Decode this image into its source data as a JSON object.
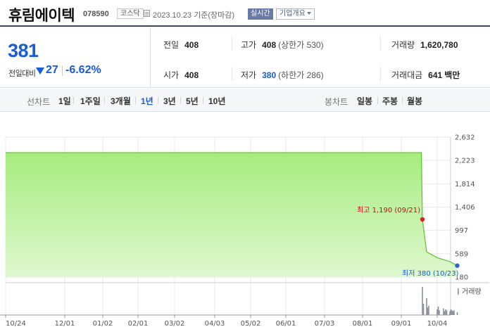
{
  "header": {
    "stock_name": "휴림에이텍",
    "stock_code": "078590",
    "market": "코스닥",
    "date_text": "2023.10.23 기준(장마감)",
    "realtime_label": "실시간",
    "company_info_label": "기업개요"
  },
  "price": {
    "current": "381",
    "change_label": "전일대비",
    "change_value": "27",
    "change_pct": "-6.62%",
    "direction": "down"
  },
  "metrics": {
    "prev_close_label": "전일",
    "prev_close": "408",
    "high_label": "고가",
    "high": "408",
    "upper_limit": "(상한가 530)",
    "volume_label": "거래량",
    "volume": "1,620,780",
    "open_label": "시가",
    "open": "408",
    "low_label": "저가",
    "low": "380",
    "lower_limit": "(하한가 286)",
    "amount_label": "거래대금",
    "amount": "641",
    "amount_unit": "백만"
  },
  "periods": {
    "line_label": "선차트",
    "line_items": [
      "1일",
      "1주일",
      "3개월",
      "1년",
      "3년",
      "5년",
      "10년"
    ],
    "active": "1년",
    "candle_label": "봉차트",
    "candle_items": [
      "일봉",
      "주봉",
      "월봉"
    ]
  },
  "colors": {
    "accent_blue": "#1a5bd6",
    "up_red": "#d0021b",
    "chart_fill": "#a6ec7f",
    "chart_line": "#5cc02e"
  },
  "chart_data": {
    "type": "area",
    "y_ticks": [
      "2,632",
      "2,223",
      "1,814",
      "1,406",
      "997",
      "589",
      "180"
    ],
    "ylim": [
      180,
      2632
    ],
    "x_ticks": [
      "10/24",
      "12/01",
      "01/02",
      "02/01",
      "03/02",
      "04/03",
      "05/02",
      "06/01",
      "07/03",
      "08/01",
      "09/01",
      "10/04"
    ],
    "series": [
      {
        "values": [
          [
            "10/24",
            2360
          ],
          [
            "12/01",
            2360
          ],
          [
            "01/02",
            2360
          ],
          [
            "02/01",
            2360
          ],
          [
            "03/02",
            2360
          ],
          [
            "04/03",
            2360
          ],
          [
            "05/02",
            2360
          ],
          [
            "06/01",
            2360
          ],
          [
            "07/03",
            2360
          ],
          [
            "08/01",
            2360
          ],
          [
            "09/01",
            2360
          ],
          [
            "09/20",
            2360
          ],
          [
            "09/21",
            1190
          ],
          [
            "09/25",
            620
          ],
          [
            "10/04",
            520
          ],
          [
            "10/16",
            450
          ],
          [
            "10/23",
            380
          ]
        ]
      }
    ],
    "annotations": {
      "high_label": "최고 1,190 (09/21)",
      "low_label": "최저 380 (10/23)"
    },
    "volume_label": "거래량",
    "volume_bars": [
      [
        "09/21",
        30
      ],
      [
        "09/22",
        12
      ],
      [
        "09/25",
        18
      ],
      [
        "09/26",
        8
      ],
      [
        "09/27",
        10
      ],
      [
        "10/04",
        6
      ],
      [
        "10/05",
        9
      ],
      [
        "10/06",
        5
      ],
      [
        "10/10",
        7
      ],
      [
        "10/11",
        4
      ],
      [
        "10/12",
        6
      ],
      [
        "10/13",
        5
      ],
      [
        "10/16",
        4
      ],
      [
        "10/17",
        6
      ],
      [
        "10/18",
        5
      ],
      [
        "10/19",
        4
      ],
      [
        "10/20",
        5
      ],
      [
        "10/23",
        3
      ]
    ]
  }
}
